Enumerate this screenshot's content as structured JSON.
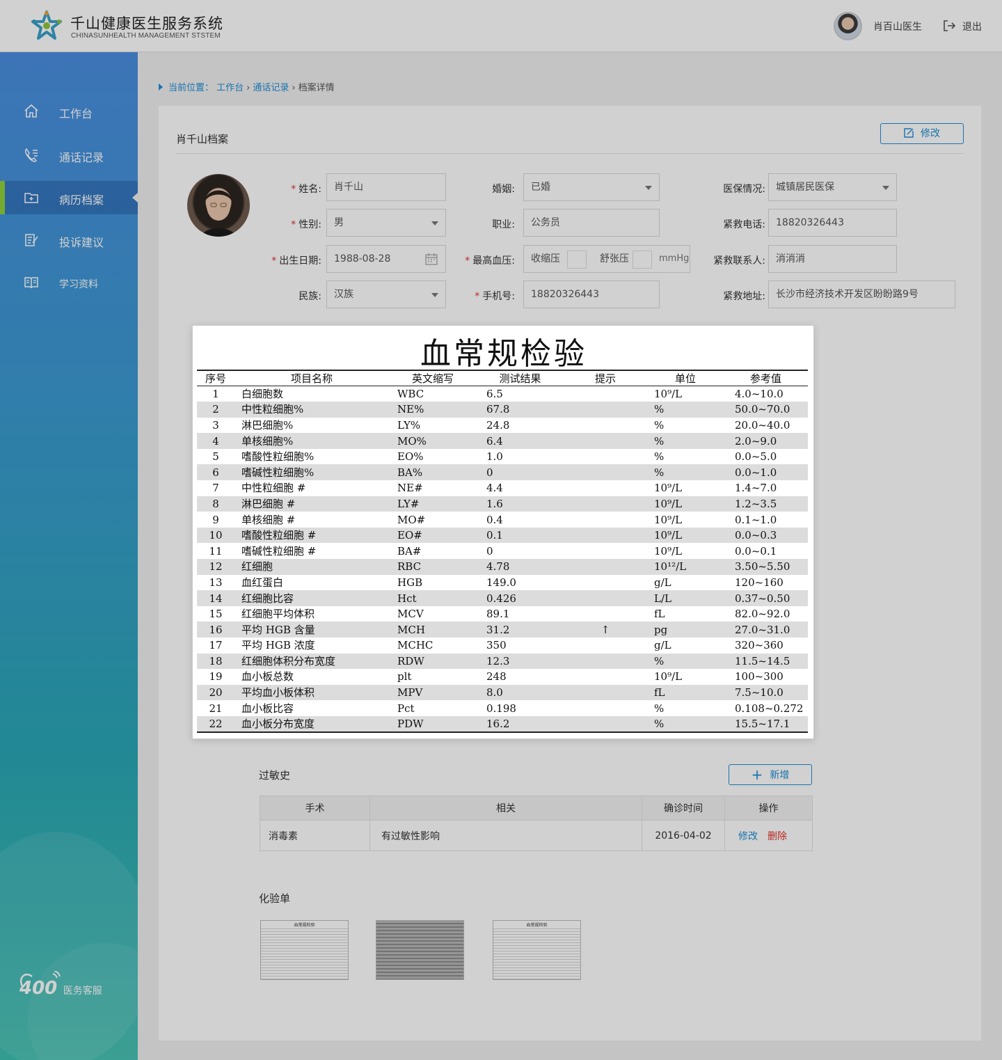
{
  "app": {
    "title": "千山健康医生服务系统",
    "subtitle": "CHINASUNHEALTH MANAGEMENT STSTEM",
    "user": "肖百山医生",
    "logout": "退出"
  },
  "sidebar": {
    "items": [
      {
        "label": "工作台",
        "icon": "home-icon"
      },
      {
        "label": "通话记录",
        "icon": "phone-list-icon"
      },
      {
        "label": "病历档案",
        "icon": "medical-folder-icon"
      },
      {
        "label": "投诉建议",
        "icon": "edit-note-icon"
      },
      {
        "label": "学习资料",
        "icon": "book-icon"
      }
    ],
    "active_index": 2,
    "service_number": "400",
    "service_text": "医务客服"
  },
  "breadcrumb": {
    "prefix": "当前位置：",
    "items": [
      "工作台",
      "通话记录",
      "档案详情"
    ]
  },
  "profile": {
    "title": "肖千山档案",
    "edit_label": "修改",
    "fields": {
      "name_label": "姓名:",
      "name": "肖千山",
      "gender_label": "性别:",
      "gender": "男",
      "birth_label": "出生日期:",
      "birth": "1988-08-28",
      "ethnic_label": "民族:",
      "ethnic": "汉族",
      "marriage_label": "婚姻:",
      "marriage": "已婚",
      "job_label": "职业:",
      "job": "公务员",
      "bp_label": "最高血压:",
      "bp_sys": "收缩压",
      "bp_dia": "舒张压",
      "bp_unit": "mmHg",
      "phone_label": "手机号:",
      "phone": "18820326443",
      "insurance_label": "医保情况:",
      "insurance": "城镇居民医保",
      "emergency_phone_label": "紧救电话:",
      "emergency_phone": "18820326443",
      "emergency_contact_label": "紧救联系人:",
      "emergency_contact": "消消消",
      "emergency_addr_label": "紧救地址:",
      "emergency_addr": "长沙市经济技术开发区盼盼路9号"
    }
  },
  "lab_report": {
    "title": "血常规检验",
    "headers": [
      "序号",
      "项目名称",
      "英文缩写",
      "测试结果",
      "提示",
      "单位",
      "参考值"
    ],
    "rows": [
      [
        "1",
        "白细胞数",
        "WBC",
        "6.5",
        "",
        "10⁹/L",
        "4.0~10.0"
      ],
      [
        "2",
        "中性粒细胞%",
        "NE%",
        "67.8",
        "",
        "%",
        "50.0~70.0"
      ],
      [
        "3",
        "淋巴细胞%",
        "LY%",
        "24.8",
        "",
        "%",
        "20.0~40.0"
      ],
      [
        "4",
        "单核细胞%",
        "MO%",
        "6.4",
        "",
        "%",
        "2.0~9.0"
      ],
      [
        "5",
        "嗜酸性粒细胞%",
        "EO%",
        "1.0",
        "",
        "%",
        "0.0~5.0"
      ],
      [
        "6",
        "嗜碱性粒细胞%",
        "BA%",
        "0",
        "",
        "%",
        "0.0~1.0"
      ],
      [
        "7",
        "中性粒细胞 #",
        "NE#",
        "4.4",
        "",
        "10⁹/L",
        "1.4~7.0"
      ],
      [
        "8",
        "淋巴细胞 #",
        "LY#",
        "1.6",
        "",
        "10⁹/L",
        "1.2~3.5"
      ],
      [
        "9",
        "单核细胞 #",
        "MO#",
        "0.4",
        "",
        "10⁹/L",
        "0.1~1.0"
      ],
      [
        "10",
        "嗜酸性粒细胞 #",
        "EO#",
        "0.1",
        "",
        "10⁹/L",
        "0.0~0.3"
      ],
      [
        "11",
        "嗜碱性粒细胞 #",
        "BA#",
        "0",
        "",
        "10⁹/L",
        "0.0~0.1"
      ],
      [
        "12",
        "红细胞",
        "RBC",
        "4.78",
        "",
        "10¹²/L",
        "3.50~5.50"
      ],
      [
        "13",
        "血红蛋白",
        "HGB",
        "149.0",
        "",
        "g/L",
        "120~160"
      ],
      [
        "14",
        "红细胞比容",
        "Hct",
        "0.426",
        "",
        "L/L",
        "0.37~0.50"
      ],
      [
        "15",
        "红细胞平均体积",
        "MCV",
        "89.1",
        "",
        "fL",
        "82.0~92.0"
      ],
      [
        "16",
        "平均 HGB 含量",
        "MCH",
        "31.2",
        "↑",
        "pg",
        "27.0~31.0"
      ],
      [
        "17",
        "平均 HGB 浓度",
        "MCHC",
        "350",
        "",
        "g/L",
        "320~360"
      ],
      [
        "18",
        "红细胞体积分布宽度",
        "RDW",
        "12.3",
        "",
        "%",
        "11.5~14.5"
      ],
      [
        "19",
        "血小板总数",
        "plt",
        "248",
        "",
        "10⁹/L",
        "100~300"
      ],
      [
        "20",
        "平均血小板体积",
        "MPV",
        "8.0",
        "",
        "fL",
        "7.5~10.0"
      ],
      [
        "21",
        "血小板比容",
        "Pct",
        "0.198",
        "",
        "%",
        "0.108~0.272"
      ],
      [
        "22",
        "血小板分布宽度",
        "PDW",
        "16.2",
        "",
        "%",
        "15.5~17.1"
      ]
    ]
  },
  "allergy": {
    "title": "过敏史",
    "add_label": "新增",
    "headers": [
      "手术",
      "相关",
      "确诊时间",
      "操作"
    ],
    "rows": [
      {
        "surgery": "消毒素",
        "related": "有过敏性影响",
        "date": "2016-04-02",
        "edit": "修改",
        "delete": "删除"
      }
    ]
  },
  "lab_sheets": {
    "title": "化验单",
    "thumb_title": "血常规检验"
  }
}
